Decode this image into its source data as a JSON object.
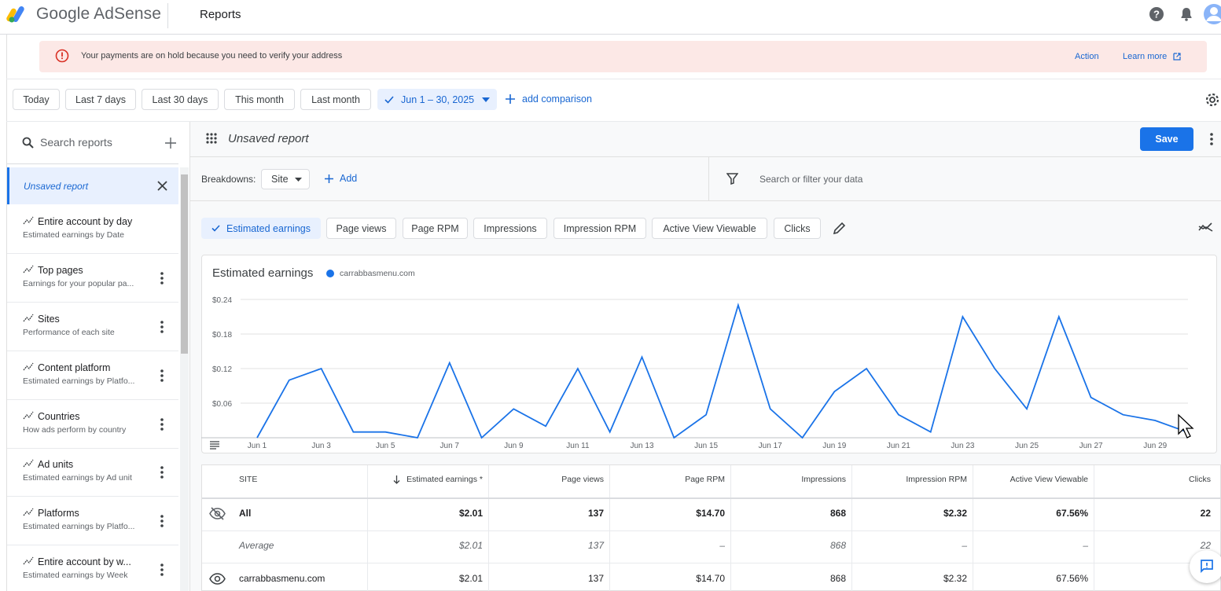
{
  "app": {
    "brand": "Google AdSense",
    "page_title": "Reports"
  },
  "alert": {
    "message": "Your payments are on hold because you need to verify your address",
    "action_label": "Action",
    "learn_more_label": "Learn more"
  },
  "date_filters": {
    "chips": [
      "Today",
      "Last 7 days",
      "Last 30 days",
      "This month",
      "Last month"
    ],
    "selected_range": "Jun 1 – 30, 2025",
    "add_comparison": "add comparison"
  },
  "sidebar": {
    "search_placeholder": "Search reports",
    "unsaved_label": "Unsaved report",
    "items": [
      {
        "title": "Entire account by day",
        "subtitle": "Estimated earnings by Date"
      },
      {
        "title": "Top pages",
        "subtitle": "Earnings for your popular pa..."
      },
      {
        "title": "Sites",
        "subtitle": "Performance of each site"
      },
      {
        "title": "Content platform",
        "subtitle": "Estimated earnings by Platfo..."
      },
      {
        "title": "Countries",
        "subtitle": "How ads perform by country"
      },
      {
        "title": "Ad units",
        "subtitle": "Estimated earnings by Ad unit"
      },
      {
        "title": "Platforms",
        "subtitle": "Estimated earnings by Platfo..."
      },
      {
        "title": "Entire account by w...",
        "subtitle": "Estimated earnings by Week"
      }
    ]
  },
  "report": {
    "name": "Unsaved report",
    "save_label": "Save",
    "breakdowns_label": "Breakdowns:",
    "breakdown_value": "Site",
    "add_label": "Add",
    "filter_placeholder": "Search or filter your data"
  },
  "metrics": {
    "chips": [
      "Estimated earnings",
      "Page views",
      "Page RPM",
      "Impressions",
      "Impression RPM",
      "Active View Viewable",
      "Clicks"
    ],
    "selected": "Estimated earnings"
  },
  "chart_data": {
    "type": "line",
    "title": "Estimated earnings",
    "series": [
      {
        "name": "carrabbasmenu.com",
        "color": "#1a73e8",
        "values": [
          0.0,
          0.1,
          0.12,
          0.01,
          0.01,
          0.0,
          0.13,
          0.0,
          0.05,
          0.02,
          0.12,
          0.01,
          0.14,
          0.0,
          0.04,
          0.23,
          0.05,
          0.0,
          0.08,
          0.12,
          0.04,
          0.01,
          0.21,
          0.12,
          0.05,
          0.21,
          0.07,
          0.04,
          0.03,
          0.01
        ]
      }
    ],
    "x": [
      "Jun 1",
      "Jun 2",
      "Jun 3",
      "Jun 4",
      "Jun 5",
      "Jun 6",
      "Jun 7",
      "Jun 8",
      "Jun 9",
      "Jun 10",
      "Jun 11",
      "Jun 12",
      "Jun 13",
      "Jun 14",
      "Jun 15",
      "Jun 16",
      "Jun 17",
      "Jun 18",
      "Jun 19",
      "Jun 20",
      "Jun 21",
      "Jun 22",
      "Jun 23",
      "Jun 24",
      "Jun 25",
      "Jun 26",
      "Jun 27",
      "Jun 28",
      "Jun 29",
      "Jun 30"
    ],
    "x_tick_labels": [
      "Jun 1",
      "Jun 3",
      "Jun 5",
      "Jun 7",
      "Jun 9",
      "Jun 11",
      "Jun 13",
      "Jun 15",
      "Jun 17",
      "Jun 19",
      "Jun 21",
      "Jun 23",
      "Jun 25",
      "Jun 27",
      "Jun 29"
    ],
    "y_tick_labels": [
      "$0.24",
      "$0.18",
      "$0.12",
      "$0.06"
    ],
    "y_ticks": [
      0.24,
      0.18,
      0.12,
      0.06
    ],
    "ylim": [
      0,
      0.24
    ],
    "grid": true,
    "legend_position": "top-left"
  },
  "table": {
    "headers": [
      "SITE",
      "Estimated earnings *",
      "Page views",
      "Page RPM",
      "Impressions",
      "Impression RPM",
      "Active View Viewable",
      "Clicks"
    ],
    "rows": [
      {
        "site": "All",
        "values": [
          "$2.01",
          "137",
          "$14.70",
          "868",
          "$2.32",
          "67.56%",
          "22"
        ]
      },
      {
        "site": "Average",
        "values": [
          "$2.01",
          "137",
          "–",
          "868",
          "–",
          "–",
          "22"
        ]
      },
      {
        "site": "carrabbasmenu.com",
        "values": [
          "$2.01",
          "137",
          "$14.70",
          "868",
          "$2.32",
          "67.56%",
          ""
        ]
      }
    ]
  },
  "colors": {
    "accent": "#1a73e8",
    "alert_bg": "#fce8e6",
    "alert_icon": "#d93025"
  }
}
